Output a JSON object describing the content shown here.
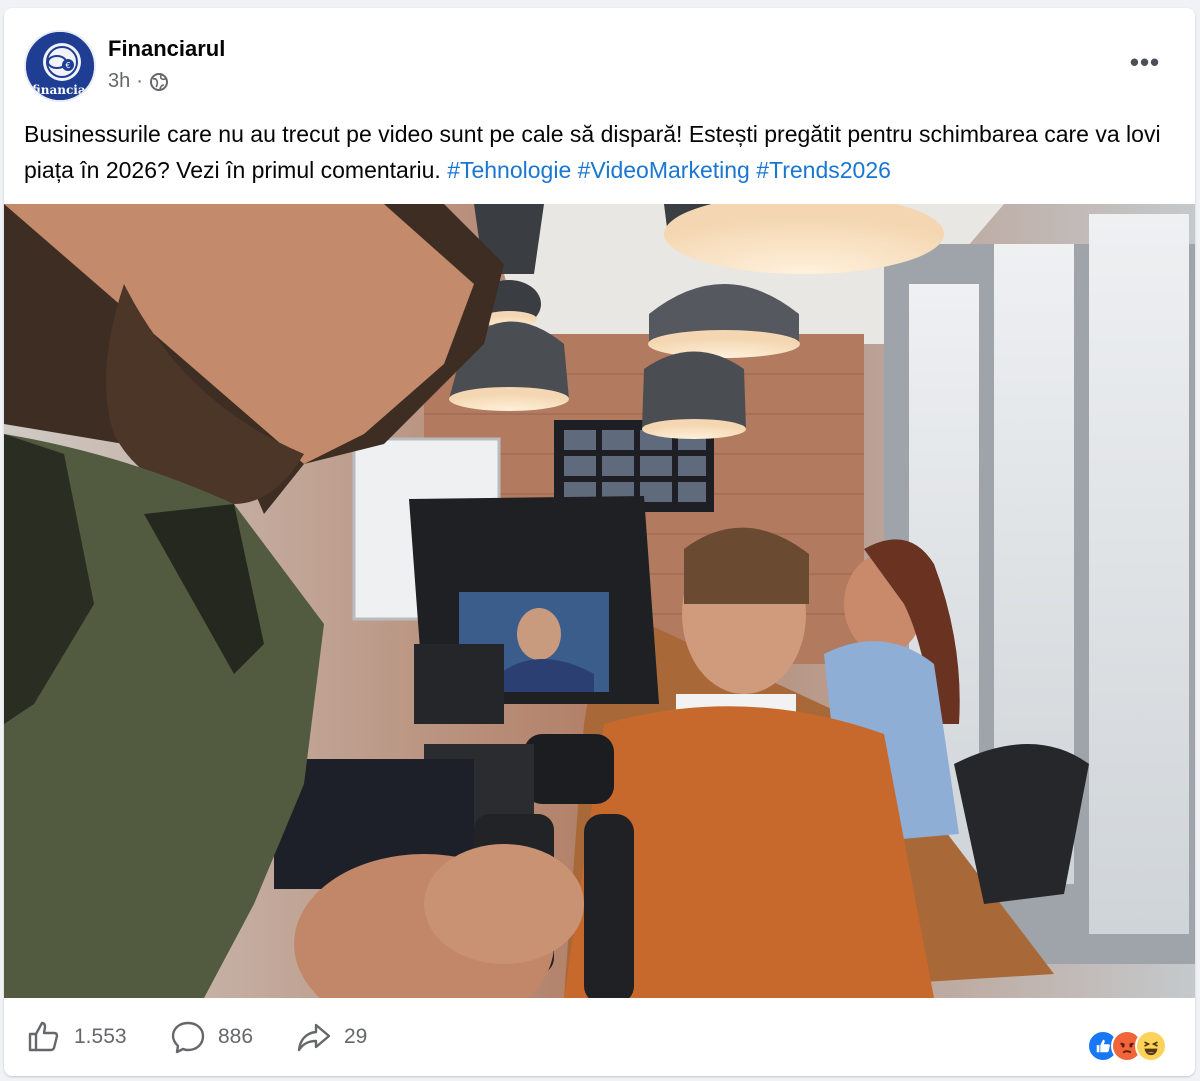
{
  "post": {
    "author": "Financiarul",
    "avatar_text": "financiarul",
    "time": "3h",
    "separator": "·",
    "text": "Businessurile care nu au trecut pe video sunt pe cale să dispară! Estești pregătit pentru schimbarea care va lovi piața în 2026? Vezi în primul comentariu.",
    "hashtags": [
      "#Tehnologie",
      "#VideoMarketing",
      "#Trends2026"
    ],
    "more_label": "•••"
  },
  "stats": {
    "likes": "1.553",
    "comments": "886",
    "shares": "29"
  },
  "reactions": [
    "like-icon",
    "angry-icon",
    "haha-icon"
  ],
  "colors": {
    "hashtag": "#1976d2",
    "like_blue": "#1877f2",
    "angry_orange": "#f0663a",
    "haha_yellow": "#fdd25a",
    "avatar_navy": "#1f3e93"
  }
}
